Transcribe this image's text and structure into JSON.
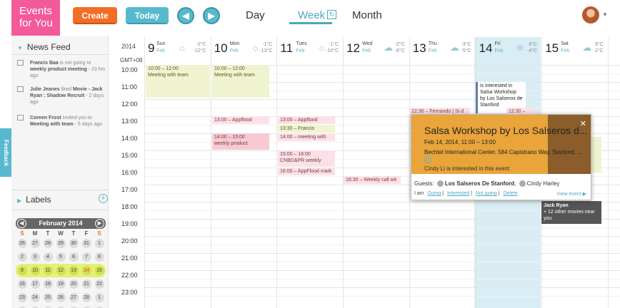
{
  "header": {
    "logo_line1": "Events",
    "logo_line2": "for You",
    "create_label": "Create",
    "today_label": "Today",
    "prev_arrow": "◀",
    "next_arrow": "▶",
    "views": [
      "Day",
      "Week",
      "Month"
    ],
    "active_view": "Week"
  },
  "sidebar": {
    "news_feed_title": "News Feed",
    "feed": [
      {
        "name": "Francis Baa",
        "text": " is not going to ",
        "event": "weekly product meeting",
        "time": " - 23 hrs ago"
      },
      {
        "name": "Julie Jeanes",
        "text": " liked ",
        "event": "Movie - Jack Ryan : Shadow Recruit",
        "time": " - 2 days ago"
      },
      {
        "name": "Coreen Frost",
        "text": " invited you to ",
        "event": "Meeting with team",
        "time": " - 5 days ago"
      }
    ],
    "labels_title": "Labels",
    "labels_plus": "+",
    "feedback_label": "Feedback",
    "minical": {
      "title": "February 2014",
      "prev": "◀",
      "next": "▶",
      "dow": [
        "S",
        "M",
        "T",
        "W",
        "T",
        "F",
        "S"
      ],
      "weeks": [
        [
          "26",
          "27",
          "28",
          "29",
          "30",
          "31",
          "1"
        ],
        [
          "2",
          "3",
          "4",
          "5",
          "6",
          "7",
          "8"
        ],
        [
          "9",
          "10",
          "11",
          "12",
          "13",
          "14",
          "15"
        ],
        [
          "16",
          "17",
          "18",
          "19",
          "20",
          "21",
          "22"
        ],
        [
          "23",
          "24",
          "25",
          "26",
          "27",
          "28",
          "1"
        ],
        [
          "2",
          "3",
          "4",
          "5",
          "6",
          "7",
          "8"
        ]
      ],
      "highlight_week": 2,
      "today": "14"
    }
  },
  "calendar": {
    "year": "2014",
    "gmt": "GMT+08",
    "days": [
      {
        "num": "9",
        "name": "Sun",
        "month": "Feb",
        "hi": "-2°C",
        "lo": "-12°C",
        "wx": "☼"
      },
      {
        "num": "10",
        "name": "Mon",
        "month": "Feb",
        "hi": "-1°C",
        "lo": "-13°C",
        "wx": "☼"
      },
      {
        "num": "11",
        "name": "Tues",
        "month": "Feb",
        "hi": "-1°C",
        "lo": "-10°C",
        "wx": "☼"
      },
      {
        "num": "12",
        "name": "Wed",
        "month": "Feb",
        "hi": "-2°C",
        "lo": "-6°C",
        "wx": "☁"
      },
      {
        "num": "13",
        "name": "Thu",
        "month": "Feb",
        "hi": "-3°C",
        "lo": "-5°C",
        "wx": "☁"
      },
      {
        "num": "14",
        "name": "Fri",
        "month": "Feb",
        "hi": "6°C",
        "lo": "-4°C",
        "wx": "≋"
      },
      {
        "num": "15",
        "name": "Sat",
        "month": "Feb",
        "hi": "6°C",
        "lo": "-2°C",
        "wx": "☁"
      }
    ],
    "hours": [
      "10:00",
      "11:00",
      "12:00",
      "13:00",
      "14:00",
      "15:00",
      "16:00",
      "17:00",
      "18:00",
      "19:00",
      "20:00",
      "21:00",
      "22:00",
      "23:00"
    ],
    "events": {
      "sun_meeting": "10:00 – 12:00\nMeeting with team",
      "mon_meeting": "10:00 – 12:00\nMeeting with team",
      "mon_appflood": "13:00 – Appflood",
      "mon_product": "14:00 – 15:00\nweekly product",
      "tue_appflood": "13:00 – Appflood",
      "tue_francis": "13:30 – Francis",
      "tue_meeting": "14:00 – meeting with he",
      "tue_cnbd": "15:00 – 16:00\nCNBD&PR weekly",
      "tue_appflood2": "16:00 – AppFlood mark",
      "wed_weekly": "16:30 – Weekly call wit",
      "thu_fernando": "12:30 – Fernando | Si d",
      "fri_salsa": "is interested in\nSalsa Workshop\nby Los Salseros de\nStanford",
      "fri_1230": "12:30 – "
    },
    "jack_ryan_title": "Jack Ryan",
    "jack_ryan_more": "+ 12 other movies near you"
  },
  "popup": {
    "title": "Salsa Workshop by Los Salseros d...",
    "date": "Feb 14, 2014, 11:00 – 13:00",
    "place": "Bechtel International Center, 584 Capistrano Way, Stanford, ...",
    "interest": "Cindy Li is interested in this event",
    "close": "✕",
    "guests_label": "Guests:",
    "guest1": "Los Salseros De Stanford",
    "guest2": "Cindy Harley",
    "iam_label": "I am",
    "actions": [
      "Going",
      "Interested",
      "Not going",
      "Delete"
    ],
    "view_event": "View event ▶"
  }
}
